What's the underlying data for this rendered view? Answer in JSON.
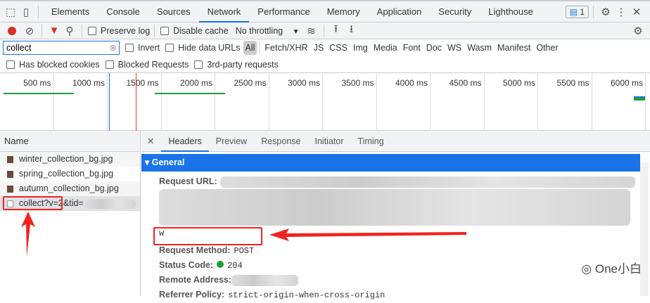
{
  "tabs": [
    "Elements",
    "Console",
    "Sources",
    "Network",
    "Performance",
    "Memory",
    "Application",
    "Security",
    "Lighthouse"
  ],
  "issues_badge": "1",
  "toolbar": {
    "preserve_log": "Preserve log",
    "disable_cache": "Disable cache",
    "throttling": "No throttling"
  },
  "filter": {
    "value": "collect",
    "invert": "Invert",
    "hide_data_urls": "Hide data URLs",
    "types": [
      "All",
      "Fetch/XHR",
      "JS",
      "CSS",
      "Img",
      "Media",
      "Font",
      "Doc",
      "WS",
      "Wasm",
      "Manifest",
      "Other"
    ],
    "has_blocked_cookies": "Has blocked cookies",
    "blocked_requests": "Blocked Requests",
    "third_party": "3rd-party requests"
  },
  "timeline_ticks": [
    "500 ms",
    "1000 ms",
    "1500 ms",
    "2000 ms",
    "2500 ms",
    "3000 ms",
    "3500 ms",
    "4000 ms",
    "4500 ms",
    "5000 ms",
    "5500 ms",
    "6000 ms"
  ],
  "requests": {
    "header": "Name",
    "items": [
      "winter_collection_bg.jpg",
      "spring_collection_bg.jpg",
      "autumn_collection_bg.jpg",
      "collect?v=2&tid="
    ]
  },
  "details": {
    "tabs": [
      "Headers",
      "Preview",
      "Response",
      "Initiator",
      "Timing"
    ],
    "section": "General",
    "request_url_label": "Request URL:",
    "url_tail": "w",
    "method_label": "Request Method:",
    "method": "POST",
    "status_label": "Status Code:",
    "status": "204",
    "remote_label": "Remote Address:",
    "referrer_label": "Referrer Policy:",
    "referrer": "strict-origin-when-cross-origin"
  },
  "watermark": "One小白"
}
